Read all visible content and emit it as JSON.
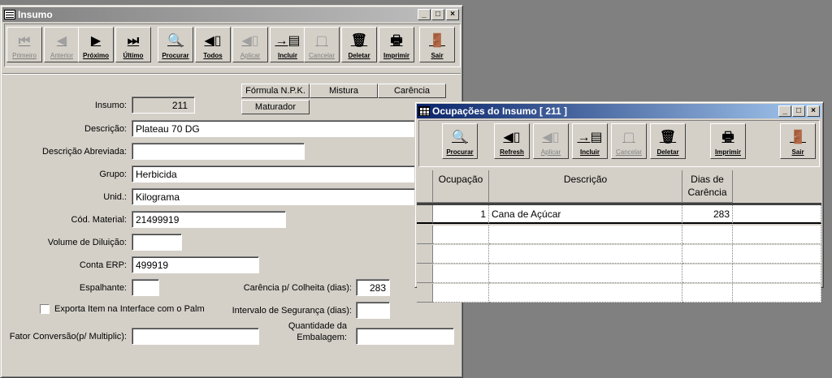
{
  "main_window": {
    "title": "Insumo",
    "toolbar": [
      {
        "label": "Primeiro",
        "icon": "⏮",
        "enabled": false
      },
      {
        "label": "Anterior",
        "icon": "◀",
        "enabled": false
      },
      {
        "label": "Próximo",
        "icon": "▶",
        "enabled": true
      },
      {
        "label": "Último",
        "icon": "⏭",
        "enabled": true
      },
      {
        "label": "Procurar",
        "icon": "🔍",
        "enabled": true
      },
      {
        "label": "Todos",
        "icon": "◀▯",
        "enabled": true
      },
      {
        "label": "Aplicar",
        "icon": "◀▯",
        "enabled": false
      },
      {
        "label": "Incluir",
        "icon": "→▤",
        "enabled": true
      },
      {
        "label": "Cancelar",
        "icon": "▢",
        "enabled": false
      },
      {
        "label": "Deletar",
        "icon": "🗑",
        "enabled": true
      },
      {
        "label": "Imprimir",
        "icon": "🖶",
        "enabled": true
      },
      {
        "label": "Sair",
        "icon": "🚪",
        "enabled": true
      }
    ],
    "tabs": {
      "formula": "Fórmula N.P.K.",
      "mistura": "Mistura",
      "carencia": "Carência",
      "maturador": "Maturador"
    },
    "form": {
      "insumo_label": "Insumo:",
      "insumo_value": "211",
      "descricao_label": "Descrição:",
      "descricao_value": "Plateau 70 DG",
      "desc_abrev_label": "Descrição Abreviada:",
      "desc_abrev_value": "",
      "grupo_label": "Grupo:",
      "grupo_value": "Herbicida",
      "unid_label": "Unid.:",
      "unid_value": "Kilograma",
      "cod_material_label": "Cód. Material:",
      "cod_material_value": "21499919",
      "volume_label": "Volume de Diluição:",
      "volume_value": "",
      "conta_erp_label": "Conta ERP:",
      "conta_erp_value": "499919",
      "espalhante_label": "Espalhante:",
      "espalhante_value": "",
      "carencia_colheita_label": "Carência p/ Colheita (dias):",
      "carencia_colheita_value": "283",
      "exporta_label": "Exporta Item na Interface com o Palm",
      "intervalo_label": "Intervalo de Segurança (dias):",
      "intervalo_value": "",
      "fator_label": "Fator Conversão(p/ Multiplic):",
      "fator_value": "",
      "quantidade_label_1": "Quantidade da",
      "quantidade_label_2": "Embalagem:",
      "quantidade_value": ""
    }
  },
  "sub_window": {
    "title": "Ocupações do Insumo [ 211 ]",
    "toolbar": [
      {
        "label": "Procurar",
        "icon": "🔍",
        "enabled": true
      },
      {
        "label": "Refresh",
        "icon": "◀▯",
        "enabled": true
      },
      {
        "label": "Aplicar",
        "icon": "◀▯",
        "enabled": false
      },
      {
        "label": "Incluir",
        "icon": "→▤",
        "enabled": true
      },
      {
        "label": "Cancelar",
        "icon": "▢",
        "enabled": false
      },
      {
        "label": "Deletar",
        "icon": "🗑",
        "enabled": true
      },
      {
        "label": "Imprimir",
        "icon": "🖶",
        "enabled": true
      },
      {
        "label": "Sair",
        "icon": "🚪",
        "enabled": true
      }
    ],
    "grid": {
      "headers": [
        "Ocupação",
        "Descrição",
        "Dias de Carência"
      ],
      "rows": [
        {
          "ocupacao": "1",
          "descricao": "Cana de Açúcar",
          "dias": "283"
        }
      ]
    }
  }
}
